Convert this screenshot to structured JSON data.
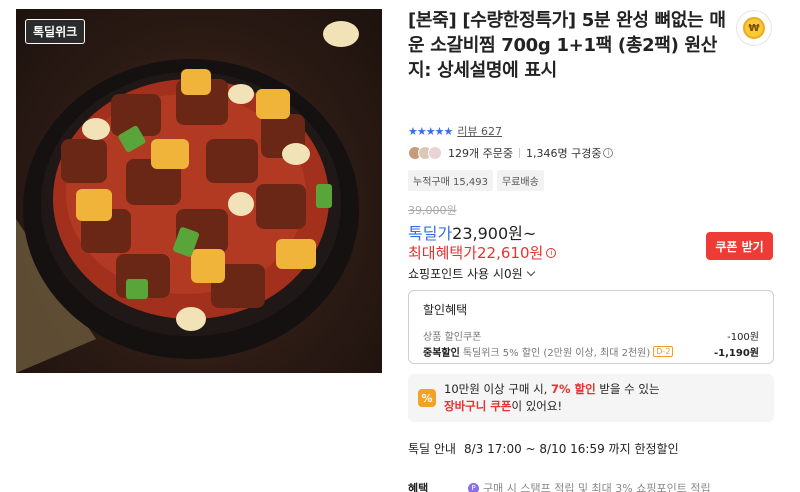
{
  "product": {
    "brand_badge": "톡딜위크",
    "title": "[본죽] [수량한정특가] 5분 완성 뼈없는 매운 소갈비찜 700g 1+1팩 (총2팩) 원산지: 상세설명에 표시",
    "image_alt": "매운 소갈비찜"
  },
  "wish": {
    "icon": "won-coin-icon",
    "symbol": "₩"
  },
  "rating": {
    "stars": "★★★★★",
    "review_label": "리뷰 627"
  },
  "buyers": {
    "ordering": "129개 주문중",
    "subscribers": "1,346명 구경중",
    "info": "i"
  },
  "tags": [
    "누적구매 15,493",
    "무료배송"
  ],
  "price": {
    "original": "39,000원",
    "deal_label": "톡딜가",
    "deal_value": "23,900원~",
    "max_label": "최대혜택가",
    "max_value": "22,610원",
    "info": "i"
  },
  "coupon_button": "쿠폰 받기",
  "points": "쇼핑포인트 사용 시0원",
  "discounts": {
    "title": "할인혜택",
    "rows": [
      {
        "label": "상품 할인쿠폰",
        "strong": "",
        "chip": "",
        "amount": "-100원"
      },
      {
        "label": "톡딜위크 5% 할인 (2만원 이상, 최대 2천원)",
        "strong": "중복할인",
        "chip": "D-2",
        "amount": "-1,190원"
      }
    ]
  },
  "promo": {
    "icon": "%",
    "line1_pre": "10만원 이상 구매 시, ",
    "line1_hl": "7% 할인",
    "line1_post": " 받을 수 있는",
    "line2_hl": "장바구니 쿠폰",
    "line2_post": "이 있어요!"
  },
  "deal_info": {
    "label": "톡딜 안내",
    "value": "8/3 17:00 ~ 8/10 16:59 까지 한정할인"
  },
  "benefit": {
    "label": "혜택",
    "icon": "P",
    "value": "구매 시 스탬프 적립 및 최대 3% 쇼핑포인트 적립"
  },
  "colors": {
    "accent_blue": "#3a6ee8",
    "accent_red": "#e8312f",
    "coupon_btn": "#ef3b36"
  }
}
